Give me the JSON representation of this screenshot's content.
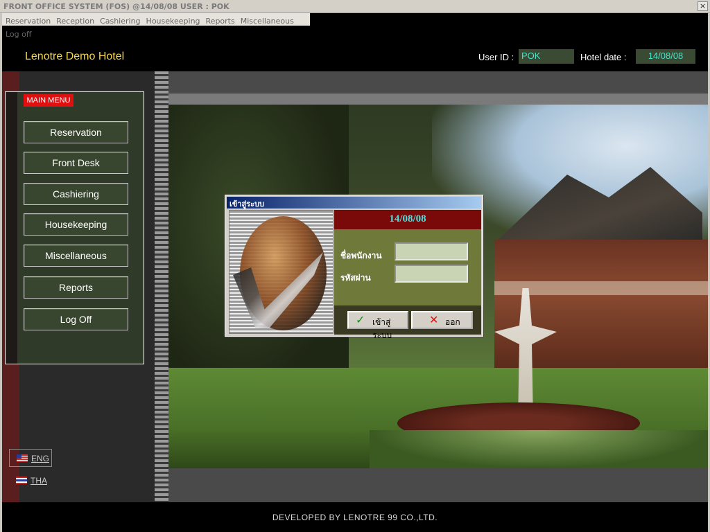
{
  "window": {
    "title": "FRONT OFFICE SYSTEM (FOS) @14/08/08    USER : POK",
    "close_glyph": "×"
  },
  "menubar": [
    "Reservation",
    "Reception",
    "Cashiering",
    "Housekeeping",
    "Reports",
    "Miscellaneous",
    "Log off"
  ],
  "header": {
    "hotel_name": "Lenotre Demo Hotel",
    "user_id_label": "User ID :",
    "user_id_value": "POK",
    "hotel_date_label": "Hotel date :",
    "hotel_date_value": "14/08/08"
  },
  "main_menu": {
    "badge": "MAIN MENU",
    "items": [
      "Reservation",
      "Front Desk",
      "Cashiering",
      "Housekeeping",
      "Miscellaneous",
      "Reports",
      "Log Off"
    ]
  },
  "languages": {
    "eng": "ENG",
    "tha": "THA"
  },
  "login_dialog": {
    "title": "เข้าสู่ระบบ",
    "date": "14/08/08",
    "username_label": "ชื่อพนักงาน",
    "password_label": "รหัสผ่าน",
    "username_value": "",
    "password_value": "",
    "login_button": "เข้าสู่ระบบ",
    "exit_button": "ออก",
    "login_icon": "checkmark-icon",
    "exit_icon": "x-icon"
  },
  "footer": {
    "text": "DEVELOPED BY  LENOTRE 99 CO.,LTD."
  },
  "colors": {
    "hotel_name": "#f5d84a",
    "field_text": "#4be0c8",
    "menu_badge": "#e01010",
    "date_bar": "#7a0a0a"
  }
}
